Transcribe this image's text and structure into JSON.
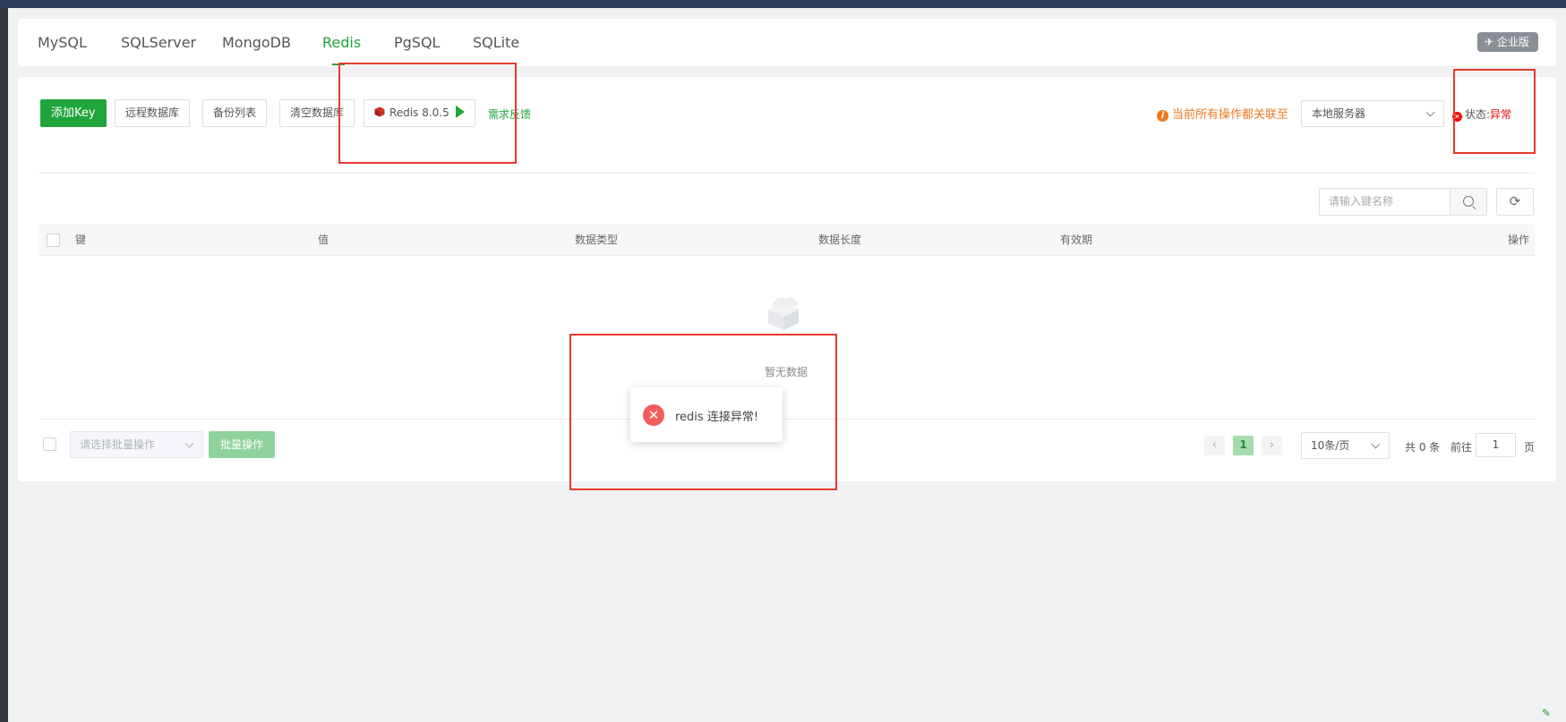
{
  "tabs": [
    {
      "label": "MySQL",
      "active": false
    },
    {
      "label": "SQLServer",
      "active": false
    },
    {
      "label": "MongoDB",
      "active": false
    },
    {
      "label": "Redis",
      "active": true
    },
    {
      "label": "PgSQL",
      "active": false
    },
    {
      "label": "SQLite",
      "active": false
    }
  ],
  "enterprise_badge": "企业版",
  "toolbar": {
    "add_key": "添加Key",
    "remote_db": "远程数据库",
    "backup_list": "备份列表",
    "clear_db": "清空数据库",
    "redis_version": "Redis 8.0.5",
    "feedback": "需求反馈"
  },
  "notice": "当前所有操作都关联至",
  "server_select": "本地服务器",
  "status": {
    "label": "状态:",
    "value": "异常"
  },
  "search": {
    "placeholder": "请输入键名称"
  },
  "table": {
    "headers": [
      "键",
      "值",
      "数据类型",
      "数据长度",
      "有效期",
      "操作"
    ],
    "empty_text": "暂无数据"
  },
  "batch": {
    "placeholder": "请选择批量操作",
    "button": "批量操作"
  },
  "pagination": {
    "prev": "‹",
    "current": "1",
    "next": "›",
    "page_size": "10条/页",
    "total": "共 0 条",
    "goto_label": "前往",
    "goto_value": "1",
    "page_label": "页"
  },
  "toast": {
    "message": "redis 连接异常!"
  },
  "colors": {
    "accent": "#20a53a",
    "error": "#ef0808",
    "warning": "#f0791e",
    "annotation": "#e8392c"
  }
}
